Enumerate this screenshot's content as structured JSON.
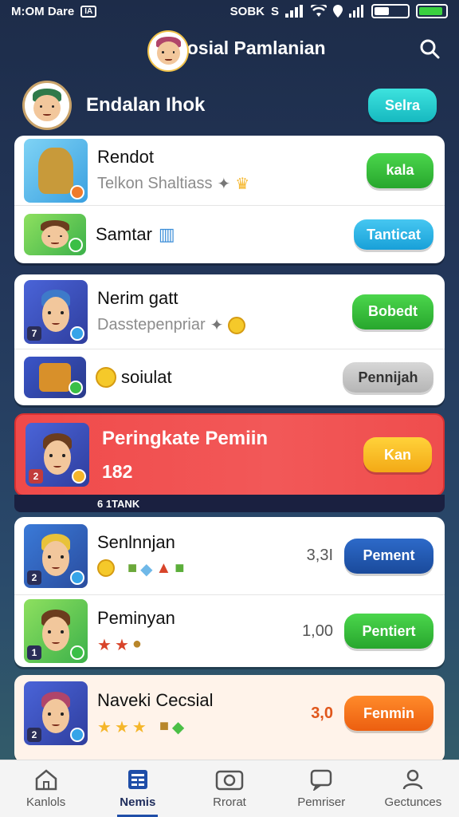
{
  "status_bar": {
    "left_text": "M:OM Dare",
    "left_badge": "IA",
    "right_text": "SOBK",
    "right_glyph": "S"
  },
  "header": {
    "title": "Sosial Pamlanian"
  },
  "profile": {
    "name": "Endalan Ihok",
    "button_label": "Selra"
  },
  "card1": {
    "rows": [
      {
        "title": "Rendot",
        "subtitle": "Telkon Shaltiass",
        "button_label": "kala"
      },
      {
        "title": "Samtar",
        "button_label": "Tanticat"
      }
    ]
  },
  "card2": {
    "rows": [
      {
        "title": "Nerim gatt",
        "subtitle": "Dasstepenpriar",
        "button_label": "Bobedt"
      },
      {
        "title": "soiulat",
        "button_label": "Pennijah"
      }
    ]
  },
  "rank": {
    "title": "Peringkate Pemiin",
    "score": "182",
    "button_label": "Kan",
    "strip_text": "6 1TANK"
  },
  "card3": {
    "rows": [
      {
        "title": "Senlnnjan",
        "value": "3,3I",
        "button_label": "Pement",
        "level": "2"
      },
      {
        "title": "Peminyan",
        "value": "1,00",
        "button_label": "Pentiert",
        "level": "1"
      }
    ]
  },
  "card4": {
    "rows": [
      {
        "title": "Naveki Cecsial",
        "value": "3,0",
        "button_label": "Fenmin",
        "level": "2"
      }
    ]
  },
  "tabs": [
    {
      "label": "Kanlols",
      "icon": "home-icon"
    },
    {
      "label": "Nemis",
      "icon": "news-icon",
      "active": true
    },
    {
      "label": "Rrorat",
      "icon": "camera-icon"
    },
    {
      "label": "Pemriser",
      "icon": "message-icon"
    },
    {
      "label": "Gectunces",
      "icon": "profile-icon"
    }
  ],
  "colors": {
    "accent_teal": "#16b9c0",
    "accent_green": "#27a62d",
    "accent_red": "#f04a4a",
    "accent_blue": "#1a4a9b",
    "accent_orange": "#ec5f10"
  }
}
